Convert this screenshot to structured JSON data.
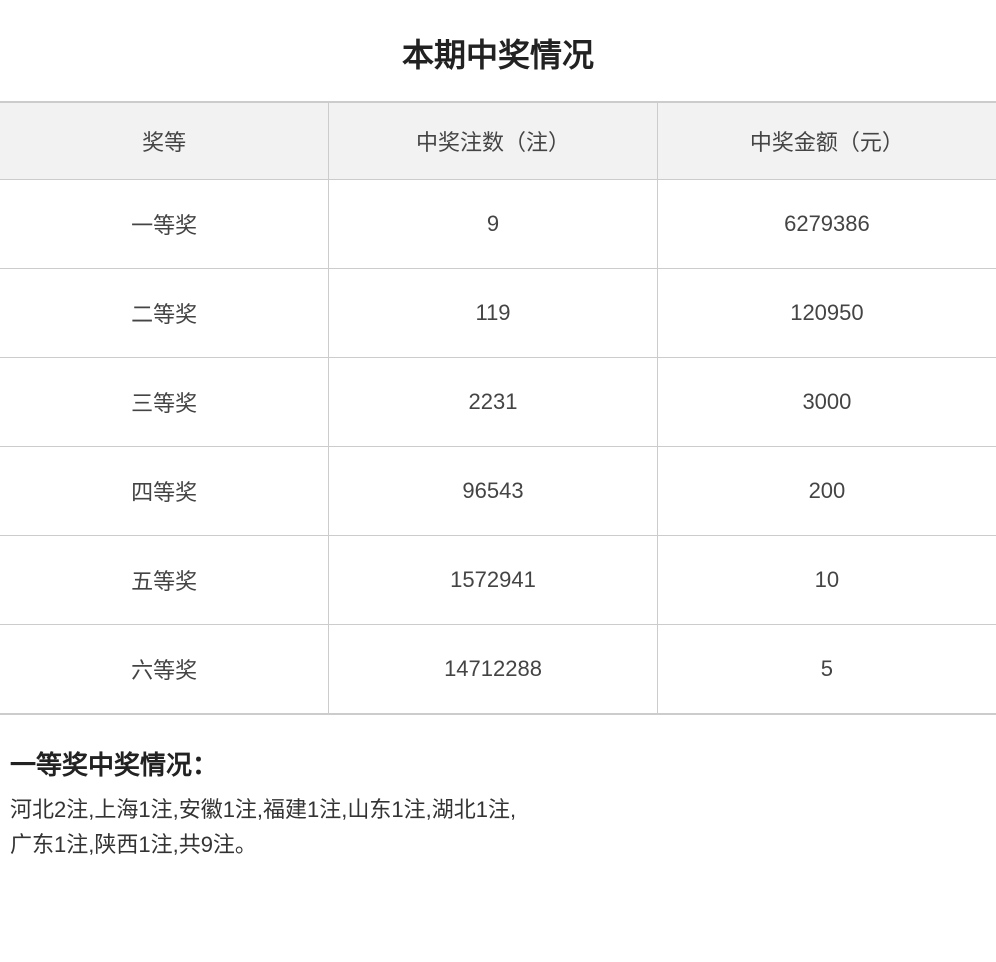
{
  "page": {
    "title": "本期中奖情况"
  },
  "table": {
    "headers": [
      "奖等",
      "中奖注数（注）",
      "中奖金额（元）"
    ],
    "rows": [
      {
        "level": "一等奖",
        "count": "9",
        "amount": "6279386"
      },
      {
        "level": "二等奖",
        "count": "119",
        "amount": "120950"
      },
      {
        "level": "三等奖",
        "count": "2231",
        "amount": "3000"
      },
      {
        "level": "四等奖",
        "count": "96543",
        "amount": "200"
      },
      {
        "level": "五等奖",
        "count": "1572941",
        "amount": "10"
      },
      {
        "level": "六等奖",
        "count": "14712288",
        "amount": "5"
      }
    ]
  },
  "prize_info": {
    "title": "一等奖中奖情况：",
    "detail": "河北2注,上海1注,安徽1注,福建1注,山东1注,湖北1注,\n广东1注,陕西1注,共9注。"
  }
}
